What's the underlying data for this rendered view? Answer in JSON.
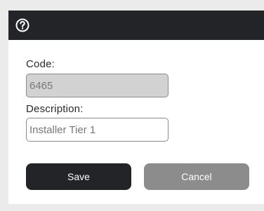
{
  "titlebar": {
    "icon": "help-circle-icon"
  },
  "form": {
    "code": {
      "label": "Code:",
      "value": "6465"
    },
    "description": {
      "label": "Description:",
      "value": "Installer Tier 1"
    }
  },
  "actions": {
    "save_label": "Save",
    "cancel_label": "Cancel"
  },
  "colors": {
    "titlebar_bg": "#222428",
    "save_bg": "#222428",
    "cancel_bg": "#8c8c8c",
    "readonly_field_bg": "#d2d2d2",
    "page_bg": "#ebebeb"
  }
}
